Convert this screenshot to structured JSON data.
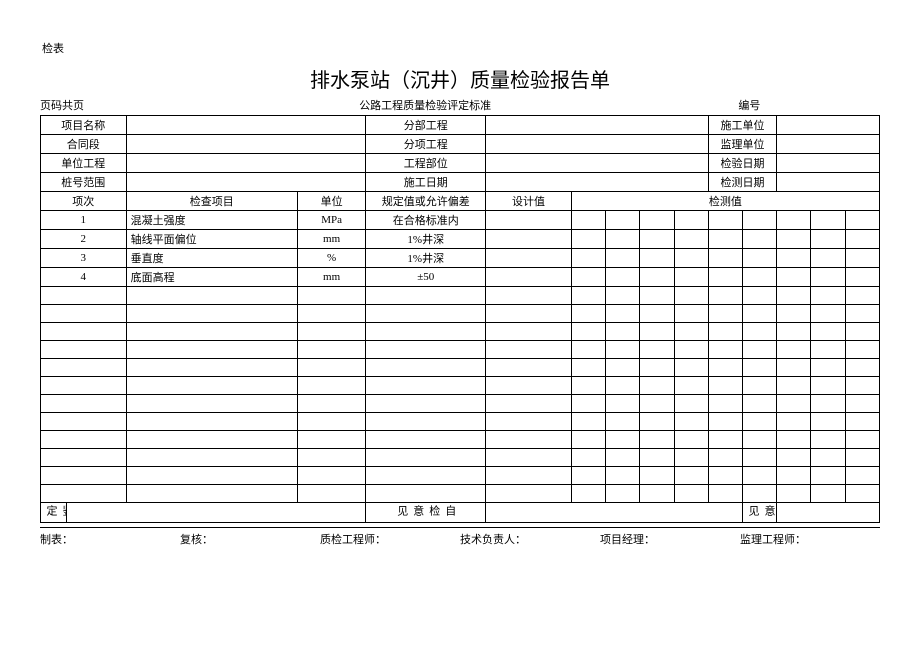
{
  "topLabel": "检表",
  "title": "排水泵站（沉井）质量检验报告单",
  "subheader": {
    "pages": "页码共页",
    "standard": "公路工程质量检验评定标准",
    "numberLabel": "编号"
  },
  "infoRows": {
    "r1c1": "项目名称",
    "r1c3": "分部工程",
    "r1c5": "施工单位",
    "r2c1": "合同段",
    "r2c3": "分项工程",
    "r2c5": "监理单位",
    "r3c1": "单位工程",
    "r3c3": "工程部位",
    "r3c5": "检验日期",
    "r4c1": "桩号范围",
    "r4c3": "施工日期",
    "r4c5": "检测日期"
  },
  "headers": {
    "seq": "项次",
    "item": "检查项目",
    "unit": "单位",
    "spec": "规定值或允许偏差",
    "design": "设计值",
    "measure": "检测值"
  },
  "rows": [
    {
      "seq": "1",
      "item": "混凝土强度",
      "unit": "MPa",
      "spec": "在合格标准内",
      "design": ""
    },
    {
      "seq": "2",
      "item": "轴线平面偏位",
      "unit": "mm",
      "spec": "1%井深",
      "design": ""
    },
    {
      "seq": "3",
      "item": "垂直度",
      "unit": "%",
      "spec": "1%井深",
      "design": ""
    },
    {
      "seq": "4",
      "item": "底面高程",
      "unit": "mm",
      "spec": "±50",
      "design": ""
    }
  ],
  "bottom": {
    "visual": "外观鉴定",
    "selfcheck": "自检意见",
    "supervise": "监理意见"
  },
  "footer": {
    "f1": "制表：",
    "f2": "复核：",
    "f3": "质检工程师：",
    "f4": "技术负责人：",
    "f5": "项目经理：",
    "f6": "监理工程师："
  }
}
